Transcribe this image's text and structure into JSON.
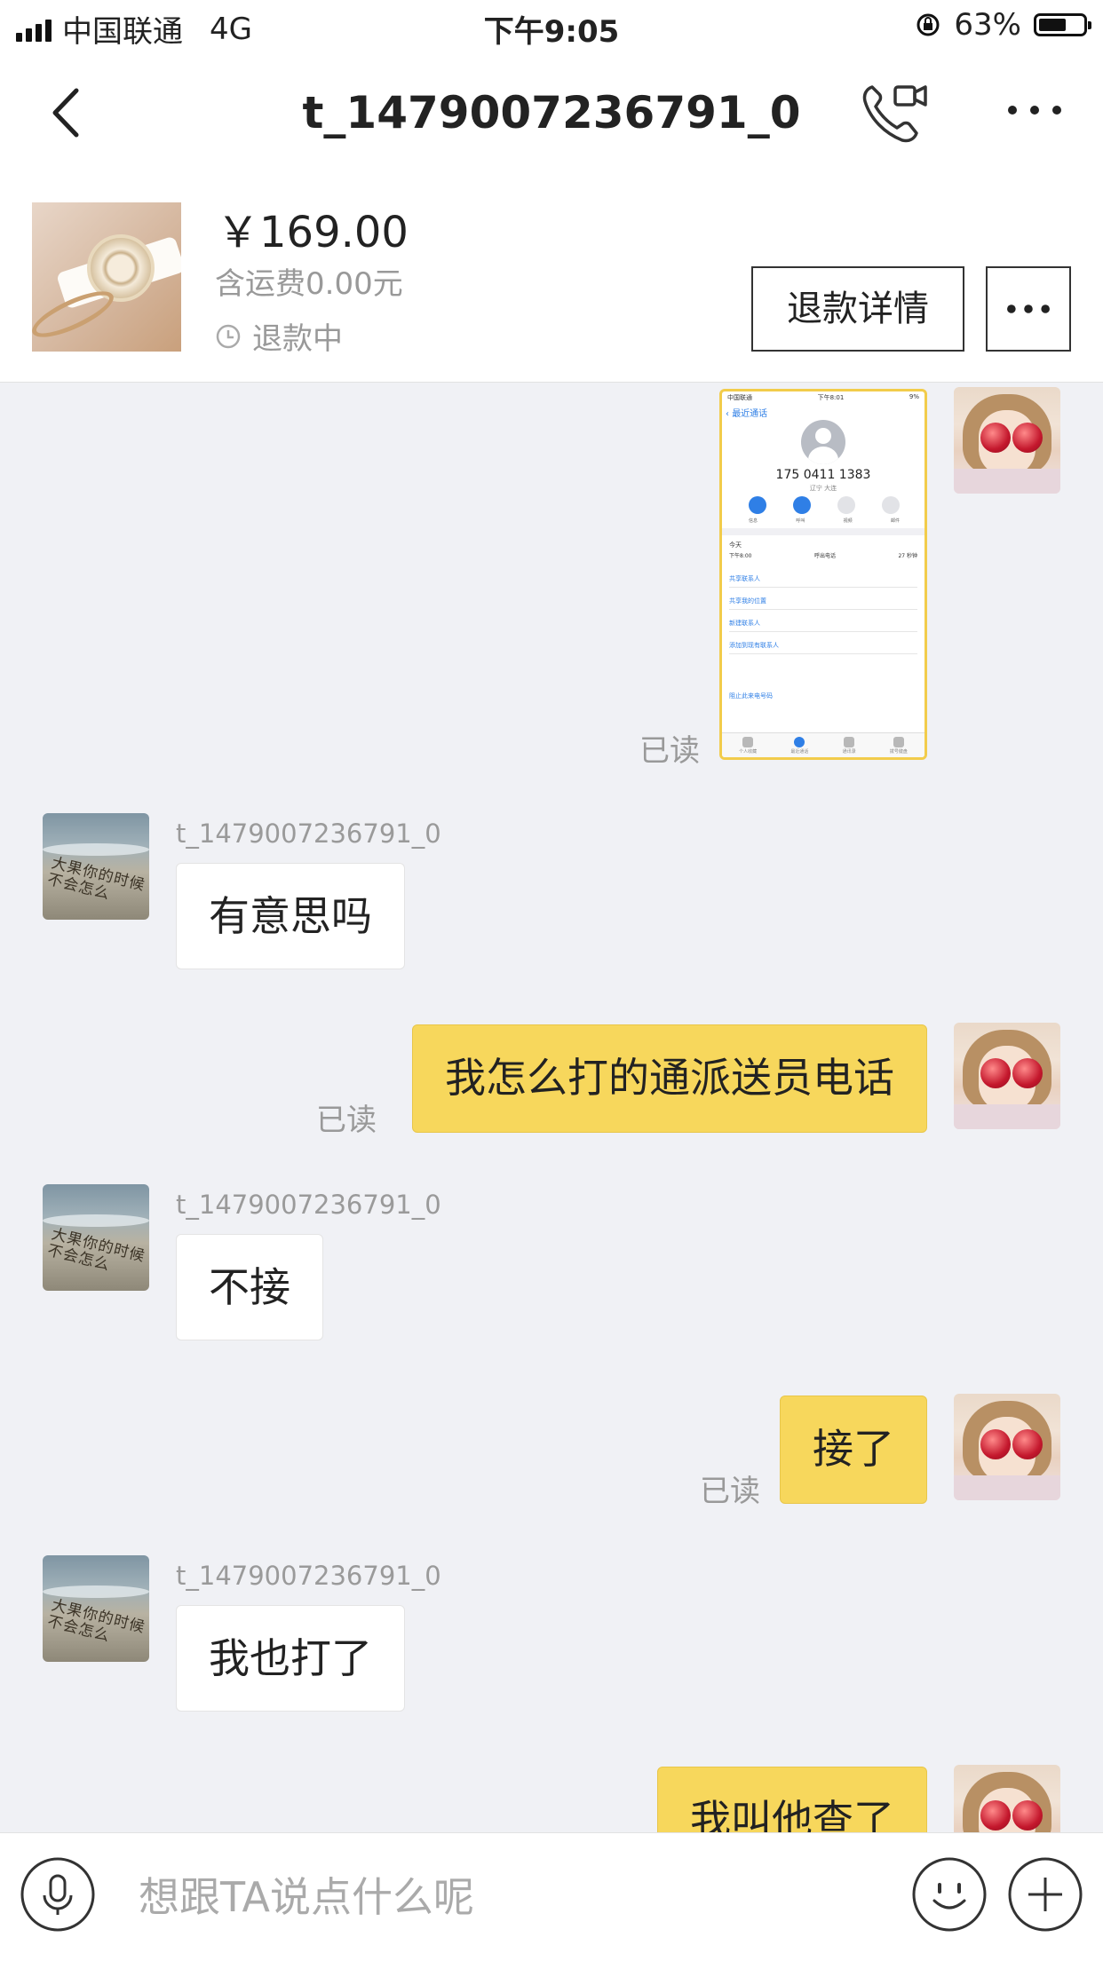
{
  "status_bar": {
    "carrier": "中国联通",
    "network": "4G",
    "time": "下午9:05",
    "battery": "63%",
    "battery_level": 0.63
  },
  "nav": {
    "title": "t_1479007236791_0",
    "back_icon": "chevron-left-icon",
    "call_icon": "phone-video-icon",
    "more_icon": "more-dots-icon"
  },
  "product": {
    "price": "￥169.00",
    "shipping": "含运费0.00元",
    "status": "退款中",
    "refund_button": "退款详情"
  },
  "chat": {
    "read_label": "已读",
    "screenshot": {
      "status_left": "中国联通",
      "status_time": "下午8:01",
      "status_right": "9%",
      "back": "最近通话",
      "number": "175 0411 1383",
      "location": "辽宁 大连",
      "action_labels": [
        "信息",
        "呼叫",
        "视频",
        "邮件"
      ],
      "today": "今天",
      "call_time": "下午8:00",
      "call_type": "呼出电话",
      "call_duration": "27 秒钟",
      "links": [
        "共享联系人",
        "共享我的位置",
        "新建联系人",
        "添加到现有联系人",
        "阻止此来电号码"
      ],
      "tabs": [
        "个人收藏",
        "最近通话",
        "通讯录",
        "拨号键盘"
      ]
    },
    "messages": [
      {
        "sender": "t_1479007236791_0",
        "text": "有意思吗"
      },
      {
        "text": "我怎么打的通派送员电话"
      },
      {
        "sender": "t_1479007236791_0",
        "text": "不接"
      },
      {
        "text": "接了"
      },
      {
        "sender": "t_1479007236791_0",
        "text": "我也打了"
      },
      {
        "text": "我叫他查了"
      }
    ],
    "avatar_text": "大果你的时候不会怎么"
  },
  "input": {
    "placeholder": "想跟TA说点什么呢"
  },
  "colors": {
    "accent": "#f7d75c",
    "background": "#f0f1f5"
  }
}
